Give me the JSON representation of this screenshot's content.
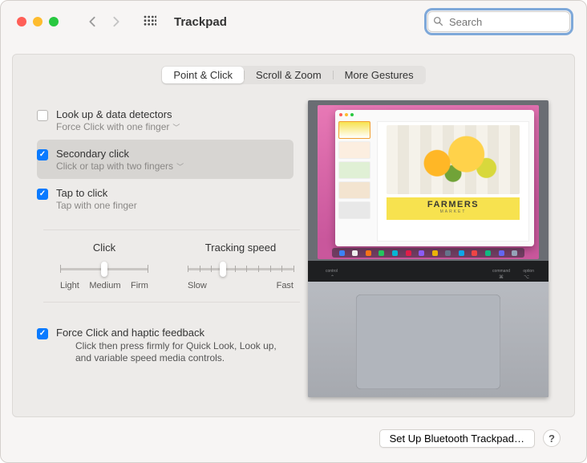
{
  "window": {
    "title": "Trackpad"
  },
  "search": {
    "placeholder": "Search",
    "value": ""
  },
  "tabs": [
    {
      "label": "Point & Click",
      "selected": true
    },
    {
      "label": "Scroll & Zoom",
      "selected": false
    },
    {
      "label": "More Gestures",
      "selected": false
    }
  ],
  "options": {
    "lookup": {
      "title": "Look up & data detectors",
      "subtitle": "Force Click with one finger",
      "checked": false,
      "has_dropdown": true
    },
    "secondary": {
      "title": "Secondary click",
      "subtitle": "Click or tap with two fingers",
      "checked": true,
      "has_dropdown": true
    },
    "tap": {
      "title": "Tap to click",
      "subtitle": "Tap with one finger",
      "checked": true,
      "has_dropdown": false
    }
  },
  "sliders": {
    "click": {
      "label": "Click",
      "marks": {
        "left": "Light",
        "mid": "Medium",
        "right": "Firm"
      },
      "ticks": 3,
      "value_index": 1
    },
    "tracking": {
      "label": "Tracking speed",
      "marks": {
        "left": "Slow",
        "right": "Fast"
      },
      "ticks": 10,
      "value_index": 3
    }
  },
  "force": {
    "title": "Force Click and haptic feedback",
    "desc": "Click then press firmly for Quick Look, Look up, and variable speed media controls.",
    "checked": true
  },
  "preview_poster": {
    "line1": "FARMERS",
    "line2": "MARKET"
  },
  "footer": {
    "bluetooth_btn": "Set Up Bluetooth Trackpad…",
    "help": "?"
  }
}
